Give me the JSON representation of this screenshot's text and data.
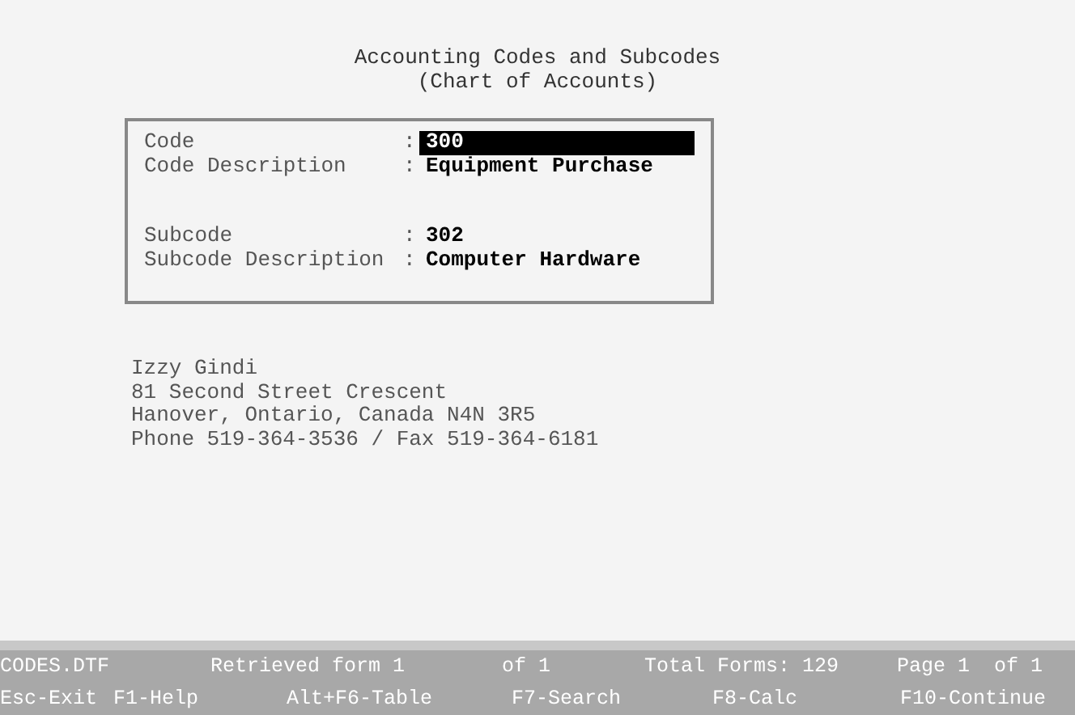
{
  "title_lines": [
    "Accounting Codes and Subcodes",
    "(Chart of Accounts)"
  ],
  "form": {
    "groups": [
      [
        {
          "label": "Code",
          "separator": ":",
          "value": "300",
          "selected": true
        },
        {
          "label": "Code Description",
          "separator": ":",
          "value": "Equipment Purchase",
          "selected": false
        }
      ],
      [
        {
          "label": "Subcode",
          "separator": ":",
          "value": "302",
          "selected": false
        },
        {
          "label": "Subcode Description",
          "separator": ":",
          "value": "Computer Hardware",
          "selected": false
        }
      ]
    ]
  },
  "address_lines": [
    "Izzy Gindi",
    "81 Second Street Crescent",
    "Hanover, Ontario, Canada N4N 3R5",
    "Phone 519-364-3536 / Fax 519-364-6181"
  ],
  "status_bar": [
    "CODES.DTF",
    "Retrieved form 1",
    "of 1",
    "Total Forms: 129",
    "Page 1  of 1"
  ],
  "key_bar": [
    "Esc-Exit",
    "F1-Help",
    "Alt+F6-Table",
    "F7-Search",
    "F8-Calc",
    "F10-Continue"
  ]
}
